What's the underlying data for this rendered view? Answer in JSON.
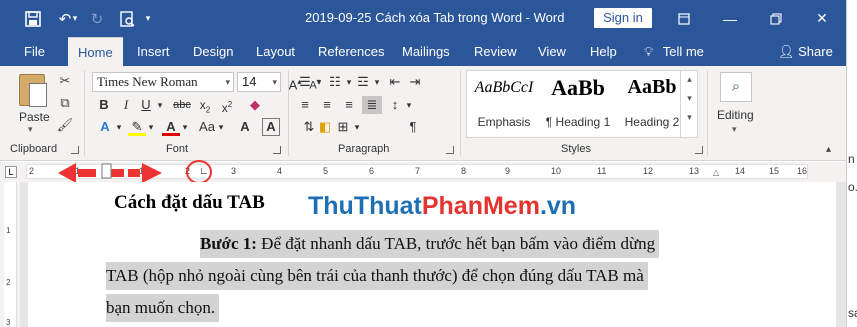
{
  "titlebar": {
    "title": "2019-09-25 Cách xóa Tab trong Word  -  Word",
    "signin": "Sign in",
    "accent": "#2b579a"
  },
  "tabs": [
    "File",
    "Home",
    "Insert",
    "Design",
    "Layout",
    "References",
    "Mailings",
    "Review",
    "View",
    "Help"
  ],
  "tellme": "Tell me",
  "share": "Share",
  "ribbon": {
    "clipboard": {
      "paste": "Paste",
      "label": "Clipboard"
    },
    "font": {
      "name": "Times New Roman",
      "size": "14",
      "label": "Font"
    },
    "paragraph": {
      "label": "Paragraph"
    },
    "styles": {
      "label": "Styles",
      "items": [
        {
          "preview": "AaBbCcI",
          "name": "Emphasis"
        },
        {
          "preview": "AaBb",
          "name": "¶ Heading 1"
        },
        {
          "preview": "AaBb",
          "name": "Heading 2"
        }
      ]
    },
    "editing": {
      "label": "Editing"
    }
  },
  "ruler": {
    "numbers": [
      "2",
      "1",
      "1",
      "2",
      "3",
      "4",
      "5",
      "6",
      "7",
      "8",
      "9",
      "10",
      "11",
      "12",
      "13",
      "14",
      "15",
      "16"
    ]
  },
  "vruler": {
    "numbers": [
      "1",
      "2",
      "3"
    ]
  },
  "document": {
    "heading": "Cách đặt dấu TAB",
    "watermark_a": "ThuThuat",
    "watermark_b": "PhanMem",
    "watermark_c": ".vn",
    "step_label": "Bước 1:",
    "line1": " Để đặt nhanh dấu TAB, trước hết bạn bấm vào điểm dừng",
    "line2": "TAB (hộp nhỏ ngoài cùng bên trái của thanh thước) để chọn đúng dấu TAB mà",
    "line3": "bạn muốn chọn."
  },
  "right_strip": {
    "t1": "n",
    "t2": "o.",
    "t3": "sa"
  }
}
